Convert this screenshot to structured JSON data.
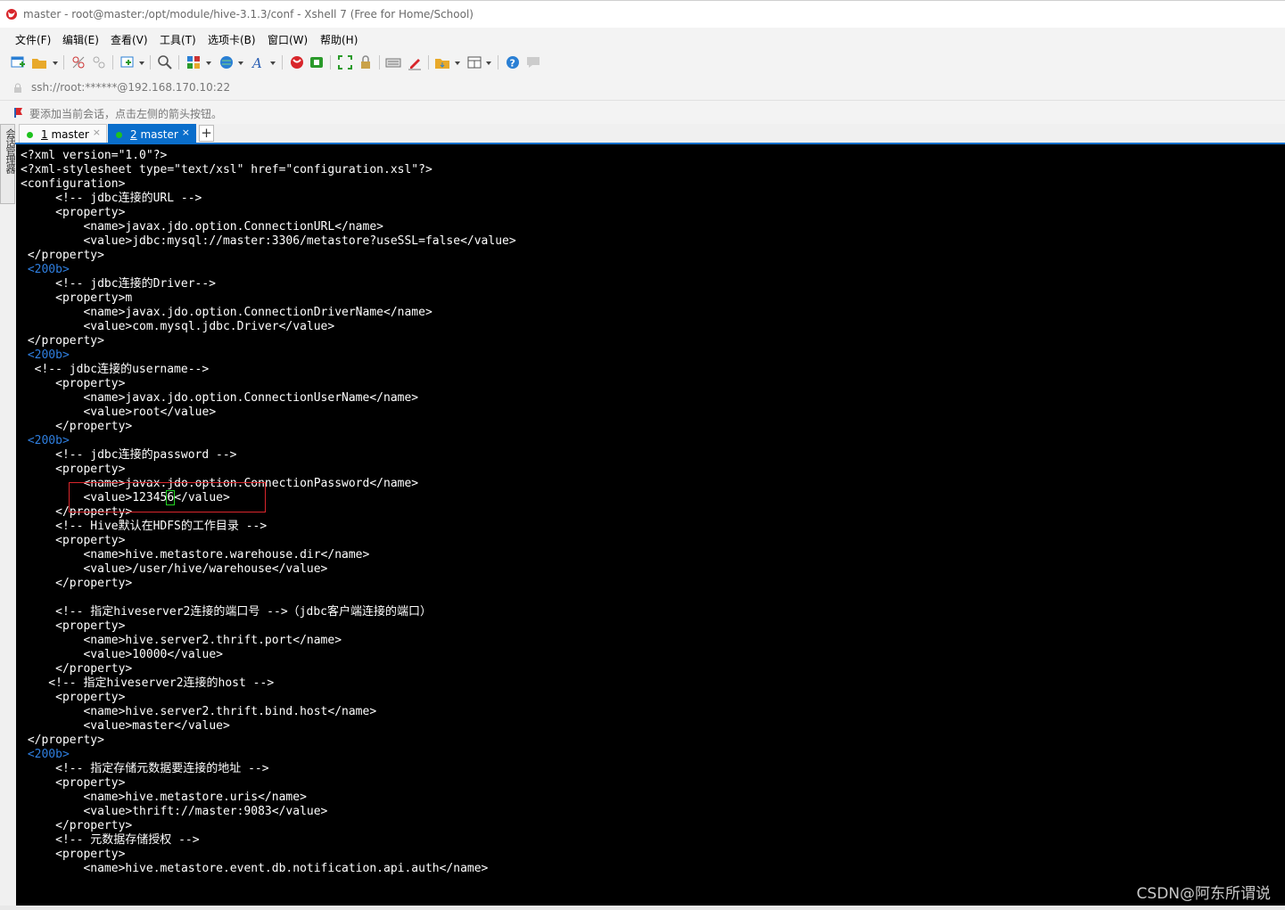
{
  "window": {
    "title": "master - root@master:/opt/module/hive-3.1.3/conf - Xshell 7 (Free for Home/School)"
  },
  "menu": [
    "文件(F)",
    "编辑(E)",
    "查看(V)",
    "工具(T)",
    "选项卡(B)",
    "窗口(W)",
    "帮助(H)"
  ],
  "toolbar": {
    "icons": [
      "new-session-icon",
      "open-folder-icon",
      "disconnect-icon",
      "reconnect-icon",
      "new-tab-icon",
      "find-icon",
      "properties-icon",
      "globe-icon",
      "font-icon",
      "xshell-icon",
      "xftp-icon",
      "fullscreen-icon",
      "lock-icon",
      "keyboard-icon",
      "highlight-icon",
      "script-icon",
      "layout-icon",
      "help-icon",
      "chat-icon"
    ]
  },
  "address": "ssh://root:******@192.168.170.10:22",
  "hint": "要添加当前会话，点击左侧的箭头按钮。",
  "side_panel_label": "会话管理器",
  "tabs": [
    {
      "number": "1",
      "label": " master",
      "active": false
    },
    {
      "number": "2",
      "label": " master",
      "active": true
    }
  ],
  "new_tab": "+",
  "terminal": {
    "lines": [
      {
        "t": "<?xml version=\"1.0\"?>"
      },
      {
        "t": "<?xml-stylesheet type=\"text/xsl\" href=\"configuration.xsl\"?>"
      },
      {
        "t": "<configuration>"
      },
      {
        "t": "     <!-- jdbc连接的URL -->"
      },
      {
        "t": "     <property>"
      },
      {
        "t": "         <name>javax.jdo.option.ConnectionURL</name>"
      },
      {
        "t": "         <value>jdbc:mysql://master:3306/metastore?useSSL=false</value>"
      },
      {
        "t": " </property>"
      },
      {
        "t": " <200b>",
        "c": "blue"
      },
      {
        "t": "     <!-- jdbc连接的Driver-->"
      },
      {
        "t": "     <property>m"
      },
      {
        "t": "         <name>javax.jdo.option.ConnectionDriverName</name>"
      },
      {
        "t": "         <value>com.mysql.jdbc.Driver</value>"
      },
      {
        "t": " </property>"
      },
      {
        "t": " <200b>",
        "c": "blue"
      },
      {
        "t": "  <!-- jdbc连接的username-->"
      },
      {
        "t": "     <property>"
      },
      {
        "t": "         <name>javax.jdo.option.ConnectionUserName</name>"
      },
      {
        "t": "         <value>root</value>"
      },
      {
        "t": "     </property>"
      },
      {
        "t": " <200b>",
        "c": "blue"
      },
      {
        "t": "     <!-- jdbc连接的password -->"
      },
      {
        "t": "     <property>"
      },
      {
        "t": "         <name>javax.jdo.option.ConnectionPassword</name>"
      },
      {
        "t": "         <value>12345",
        "cursor": "6",
        "after": "</value>"
      },
      {
        "t": "     </property>"
      },
      {
        "t": "     <!-- Hive默认在HDFS的工作目录 -->"
      },
      {
        "t": "     <property>"
      },
      {
        "t": "         <name>hive.metastore.warehouse.dir</name>"
      },
      {
        "t": "         <value>/user/hive/warehouse</value>"
      },
      {
        "t": "     </property>"
      },
      {
        "t": ""
      },
      {
        "t": "     <!-- 指定hiveserver2连接的端口号 -->（jdbc客户端连接的端口）"
      },
      {
        "t": "     <property>"
      },
      {
        "t": "         <name>hive.server2.thrift.port</name>"
      },
      {
        "t": "         <value>10000</value>"
      },
      {
        "t": "     </property>"
      },
      {
        "t": "    <!-- 指定hiveserver2连接的host -->"
      },
      {
        "t": "     <property>"
      },
      {
        "t": "         <name>hive.server2.thrift.bind.host</name>"
      },
      {
        "t": "         <value>master</value>"
      },
      {
        "t": " </property>"
      },
      {
        "t": " <200b>",
        "c": "blue"
      },
      {
        "t": "     <!-- 指定存储元数据要连接的地址 -->"
      },
      {
        "t": "     <property>"
      },
      {
        "t": "         <name>hive.metastore.uris</name>"
      },
      {
        "t": "         <value>thrift://master:9083</value>"
      },
      {
        "t": "     </property>"
      },
      {
        "t": "     <!-- 元数据存储授权 -->"
      },
      {
        "t": "     <property>"
      },
      {
        "t": "         <name>hive.metastore.event.db.notification.api.auth</name>"
      }
    ]
  },
  "watermark": "CSDN@阿东所谓说"
}
